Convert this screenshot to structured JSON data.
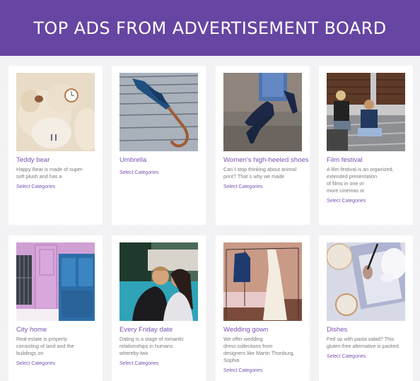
{
  "header": {
    "title": "TOP ADS FROM ADVERTISEMENT BOARD"
  },
  "colors": {
    "brand": "#6745a2",
    "accent_text": "#7952b3",
    "body_text": "#7a7a7a"
  },
  "ads": [
    {
      "title": "Teddy bear",
      "image": "teddy-bear-photo",
      "description_lines": [
        "Happy Bear is made of super-",
        "soft plush and has a"
      ],
      "link": "Select Categories"
    },
    {
      "title": "Umbrella",
      "image": "umbrella-photo",
      "description_lines": [],
      "link": "Select Categories"
    },
    {
      "title": "Women's high-heeled shoes",
      "image": "high-heeled-shoes-photo",
      "description_lines": [
        "Can`t stop thinking about animal",
        "print? That`s why we made"
      ],
      "link": "Select Categories"
    },
    {
      "title": "Film festival",
      "image": "film-festival-photo",
      "description_lines": [
        "A film festival is an organized,",
        "extended presentation",
        "of films in one or",
        "more cinemas or"
      ],
      "link": "Select Categories"
    },
    {
      "title": "City home",
      "image": "city-home-photo",
      "description_lines": [
        "Real estate is property",
        "consisting of land and the",
        "buildings on"
      ],
      "link": "Select Categories"
    },
    {
      "title": "Every Friday date",
      "image": "friday-date-photo",
      "description_lines": [
        "Dating is a stage of romantic",
        "relationships in humans",
        "whereby two"
      ],
      "link": "Select Categories"
    },
    {
      "title": "Wedding gown",
      "image": "wedding-gown-photo",
      "description_lines": [
        "We offer wedding",
        "dress collections from",
        "designers like Martin Thonburg,",
        "Sophia"
      ],
      "link": "Select Categories"
    },
    {
      "title": "Dishes",
      "image": "dishes-photo",
      "description_lines": [
        "Fed up with pasta salad? This",
        "gluten-free alternative is packed"
      ],
      "link": "Select Categories"
    }
  ]
}
